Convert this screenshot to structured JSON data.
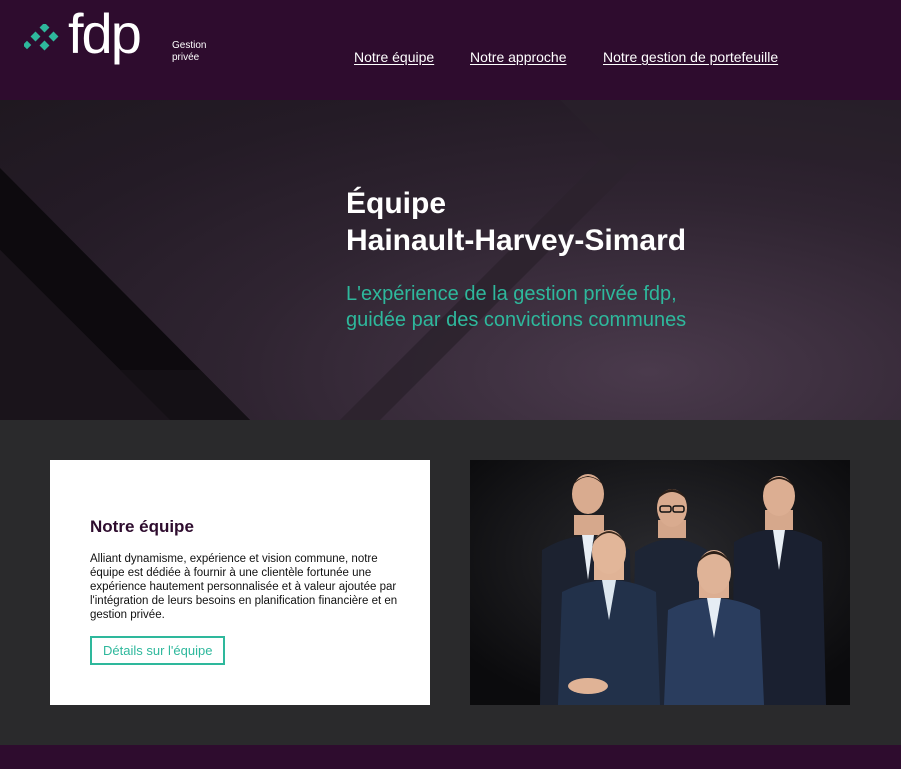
{
  "header": {
    "logo_text": "fdp",
    "logo_sub_line1": "Gestion",
    "logo_sub_line2": "privée",
    "nav": [
      {
        "label": "Notre équipe"
      },
      {
        "label": "Notre approche"
      },
      {
        "label": "Notre gestion de portefeuille"
      }
    ]
  },
  "hero": {
    "title_line1": "Équipe",
    "title_line2": "Hainault-Harvey-Simard",
    "subtitle_line1": "L'expérience de la gestion privée fdp,",
    "subtitle_line2": "guidée par des convictions communes"
  },
  "team_card": {
    "title": "Notre équipe",
    "text": "Alliant dynamisme, expérience et vision commune, notre équipe est dédiée à fournir à une clientèle fortunée une expérience hautement personnalisée et à valeur ajoutée par l'intégration de leurs besoins en planification financière et en gestion privée.",
    "button_label": "Détails sur l'équipe"
  },
  "colors": {
    "header_bg": "#2e0c2e",
    "accent": "#2eb89c",
    "content_bg": "#2a2a2c"
  }
}
